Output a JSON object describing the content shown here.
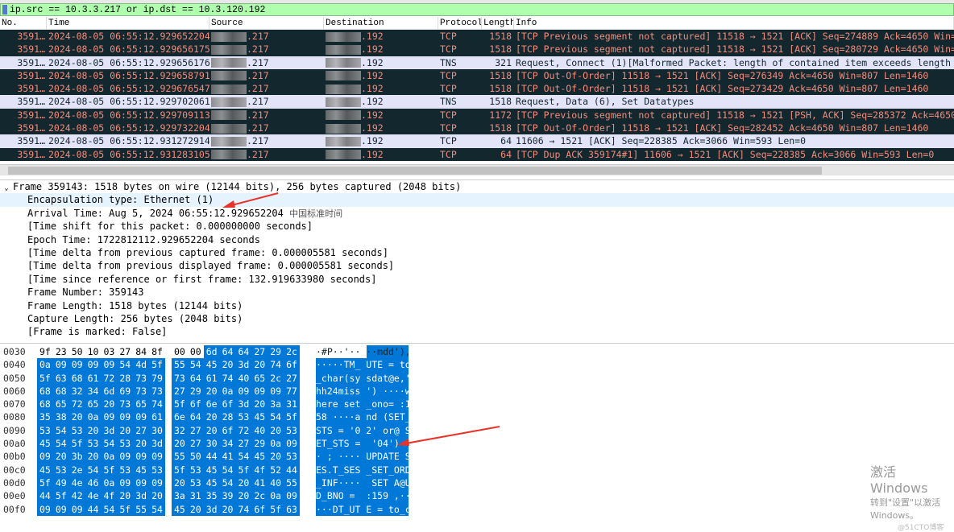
{
  "filter": {
    "value": "ip.src == 10.3.3.217 or ip.dst == 10.3.120.192",
    "bg": "#afffaf"
  },
  "columns": [
    "No.",
    "Time",
    "Source",
    "Destination",
    "Protocol",
    "Length",
    "Info"
  ],
  "colors": {
    "dark_row_bg": "#12272e",
    "dark_row_fg": "#f78b7b",
    "light_row_bg": "#e4e4f8",
    "selection": "#0078d7"
  },
  "packets": [
    {
      "no": "3591…",
      "time": "2024-08-05 06:55:12.929652204",
      "src": ".217",
      "dst": ".192",
      "proto": "TCP",
      "len": "1518",
      "info": "[TCP Previous segment not captured] 11518 → 1521 [ACK] Seq=274889 Ack=4650 Win=8",
      "style": "dark"
    },
    {
      "no": "3591…",
      "time": "2024-08-05 06:55:12.929656175",
      "src": ".217",
      "dst": ".192",
      "proto": "TCP",
      "len": "1518",
      "info": "[TCP Previous segment not captured] 11518 → 1521 [ACK] Seq=280729 Ack=4650 Win=8",
      "style": "dark"
    },
    {
      "no": "3591…",
      "time": "2024-08-05 06:55:12.929656176",
      "src": ".217",
      "dst": ".192",
      "proto": "TNS",
      "len": "321",
      "info": "Request, Connect (1)[Malformed Packet: length of contained item exceeds length o",
      "style": "light"
    },
    {
      "no": "3591…",
      "time": "2024-08-05 06:55:12.929658791",
      "src": ".217",
      "dst": ".192",
      "proto": "TCP",
      "len": "1518",
      "info": "[TCP Out-Of-Order] 11518 → 1521 [ACK] Seq=276349 Ack=4650 Win=807 Len=1460",
      "style": "dark"
    },
    {
      "no": "3591…",
      "time": "2024-08-05 06:55:12.929676547",
      "src": ".217",
      "dst": ".192",
      "proto": "TCP",
      "len": "1518",
      "info": "[TCP Out-Of-Order] 11518 → 1521 [ACK] Seq=273429 Ack=4650 Win=807 Len=1460",
      "style": "dark"
    },
    {
      "no": "3591…",
      "time": "2024-08-05 06:55:12.929702061",
      "src": ".217",
      "dst": ".192",
      "proto": "TNS",
      "len": "1518",
      "info": "Request, Data (6), Set Datatypes",
      "style": "light"
    },
    {
      "no": "3591…",
      "time": "2024-08-05 06:55:12.929709113",
      "src": ".217",
      "dst": ".192",
      "proto": "TCP",
      "len": "1172",
      "info": "[TCP Previous segment not captured] 11518 → 1521 [PSH, ACK] Seq=285372 Ack=4650",
      "style": "dark"
    },
    {
      "no": "3591…",
      "time": "2024-08-05 06:55:12.929732204",
      "src": ".217",
      "dst": ".192",
      "proto": "TCP",
      "len": "1518",
      "info": "[TCP Out-Of-Order] 11518 → 1521 [ACK] Seq=282452 Ack=4650 Win=807 Len=1460",
      "style": "dark"
    },
    {
      "no": "3591…",
      "time": "2024-08-05 06:55:12.931272914",
      "src": ".217",
      "dst": ".192",
      "proto": "TCP",
      "len": "64",
      "info": "11606 → 1521 [ACK] Seq=228385 Ack=3066 Win=593 Len=0",
      "style": "light"
    },
    {
      "no": "3591…",
      "time": "2024-08-05 06:55:12.931283105",
      "src": ".217",
      "dst": ".192",
      "proto": "TCP",
      "len": "64",
      "info": "[TCP Dup ACK 359174#1] 11606 → 1521 [ACK] Seq=228385 Ack=3066 Win=593 Len=0",
      "style": "dark"
    }
  ],
  "detail": {
    "frame": "Frame 359143: 1518 bytes on wire (12144 bits), 256 bytes captured (2048 bits)",
    "fields": [
      "Encapsulation type: Ethernet (1)",
      "Arrival Time: Aug  5, 2024 06:55:12.929652204",
      "[Time shift for this packet: 0.000000000 seconds]",
      "Epoch Time: 1722812112.929652204 seconds",
      "[Time delta from previous captured frame: 0.000005581 seconds]",
      "[Time delta from previous displayed frame: 0.000005581 seconds]",
      "[Time since reference or first frame: 132.919633980 seconds]",
      "Frame Number: 359143",
      "Frame Length: 1518 bytes (12144 bits)",
      "Capture Length: 256 bytes (2048 bits)",
      "[Frame is marked: False]"
    ],
    "timezone": "中国标准时间"
  },
  "hex": {
    "selection_start_byte": 10,
    "lines": [
      {
        "off": "0030",
        "bytes": "9f 23 50 10 03 27 84 8f 00 00 6d 64 64 27 29 2c",
        "ascii": "·#P··'·· ··mdd'),"
      },
      {
        "off": "0040",
        "bytes": "0a 09 09 09 09 54 4d 5f 55 54 45 20 3d 20 74 6f",
        "ascii": "·····TM_ UTE = to"
      },
      {
        "off": "0050",
        "bytes": "5f 63 68 61 72 28 73 79 73 64 61 74 40 65 2c 27",
        "ascii": "_char(sy sdat@e,'"
      },
      {
        "off": "0060",
        "bytes": "68 68 32 34 6d 69 73 73 27 29 20 0a 09 09 09 77",
        "ascii": "hh24miss ') ····w"
      },
      {
        "off": "0070",
        "bytes": "68 65 72 65 20 73 65 74 5f 6f 6e 6f 3d 20 3a 31",
        "ascii": "here set _ono= :1"
      },
      {
        "off": "0080",
        "bytes": "35 38 20 0a 09 09 09 61 6e 64 20 28 53 45 54 5f",
        "ascii": "58 ····a nd (SET_"
      },
      {
        "off": "0090",
        "bytes": "53 54 53 20 3d 20 27 30 32 27 20 6f 72 40 20 53",
        "ascii": "STS = '0 2' or@ S"
      },
      {
        "off": "00a0",
        "bytes": "45 54 5f 53 54 53 20 3d 20 27 30 34 27 29 0a 09",
        "ascii": "ET_STS =  '04')··"
      },
      {
        "off": "00b0",
        "bytes": "09 20 3b 20 0a 09 09 09 55 50 44 41 54 45 20 53",
        "ascii": "· ; ···· UPDATE S"
      },
      {
        "off": "00c0",
        "bytes": "45 53 2e 54 5f 53 45 53 5f 53 45 54 5f 4f 52 44",
        "ascii": "ES.T_SES _SET_ORD"
      },
      {
        "off": "00d0",
        "bytes": "5f 49 4e 46 0a 09 09 09 20 53 45 54 20 41 40 55",
        "ascii": "_INF····  SET A@U"
      },
      {
        "off": "00e0",
        "bytes": "44 5f 42 4e 4f 20 3d 20 3a 31 35 39 20 2c 0a 09",
        "ascii": "D_BNO =  :159 ,··"
      },
      {
        "off": "00f0",
        "bytes": "09 09 09 44 54 5f 55 54 45 20 3d 20 74 6f 5f 63",
        "ascii": "···DT_UT E = to_c"
      }
    ]
  },
  "watermark": {
    "line1": "激活 Windows",
    "line2": "转到\"设置\"以激活 Windows。",
    "line3": "@51CTO博客"
  }
}
